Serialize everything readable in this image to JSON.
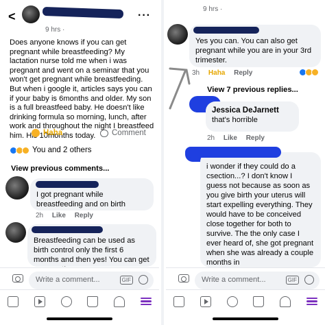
{
  "left": {
    "post_time": "9 hrs ·",
    "post_text": "Does anyone knows if you can get pregnant while breastfeeding? My lactation nurse told me when i was pregnant and went on a seminar that you won't get pregnant while breastfeeding. But when i google it, articles says you can if your baby is 6months and older. My son is a full breastfeed baby. He doesn't like drinking formula so morning, lunch, after work and throughout the night I breastfeed him. His 10months today.",
    "haha_label": "Haha",
    "comment_label": "Comment",
    "reactions_text": "You and 2 others",
    "view_previous": "View previous comments...",
    "comments": [
      {
        "text": "I got pregnant while breastfeeding and on birth control.",
        "time": "2h",
        "like": "Like",
        "reply": "Reply"
      },
      {
        "text": "Breastfeeding can be used as birth control only the first 6 months and then yes! You can get pregnant!"
      }
    ],
    "input_placeholder": "Write a comment...",
    "gif_label": "GIF"
  },
  "right": {
    "post_time": "9 hrs ·",
    "comments": [
      {
        "text": "Yes you can. You can also get pregnant while you are in your 3rd trimester.",
        "time": "3h",
        "haha": "Haha",
        "reply": "Reply"
      },
      {
        "name": "Jessica DeJarnett",
        "text": "that's horrible",
        "time": "2h",
        "like": "Like",
        "reply": "Reply"
      },
      {
        "text": "i wonder if they could do a csection...? I don't know I guess not because as soon as you give birth your uterus will start expelling everything. They would have to be conceived close together for both to survive. The the only case I ever heard of, she got pregnant when she was already a couple months in"
      }
    ],
    "view_replies": "View 7 previous replies...",
    "input_placeholder": "Write a comment...",
    "gif_label": "GIF"
  },
  "colors": {
    "accent_purple": "#7b2fbf",
    "scribble_blue": "#1f3fe0",
    "haha_gold": "#e6a700"
  }
}
